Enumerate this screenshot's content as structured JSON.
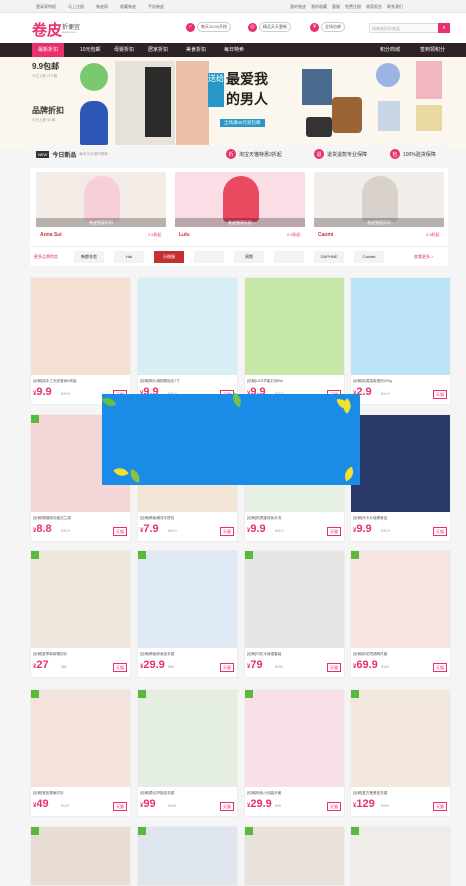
{
  "topbar": {
    "left": [
      "登录享特权",
      "马上注册",
      "卷皮网",
      "收藏卷皮",
      "手机卷皮"
    ],
    "right": [
      "我的卷皮",
      "我的收藏",
      "客服",
      "免费注册",
      "商家报名",
      "联系我们"
    ]
  },
  "header": {
    "logo": "卷皮",
    "logo_sub": "折便宜",
    "logo_url": "juanpi.com",
    "features": [
      {
        "icon": "✓",
        "text": "每天10:00开抢"
      },
      {
        "icon": "◎",
        "text": "精品天天更新"
      },
      {
        "icon": "¥",
        "text": "全场包邮"
      }
    ],
    "search_placeholder": "搜卷皮折扣商品",
    "search_icon": "search-icon"
  },
  "nav": {
    "items": [
      "最新折扣",
      "10元包邮",
      "母婴折扣",
      "居家折扣",
      "美食折扣",
      "每日特卖",
      "积分商城",
      "签到领积分"
    ],
    "active": 0
  },
  "banner": {
    "left1": "9.9包邮",
    "left1_sub": "今日上新 275 款",
    "left2": "品牌折扣",
    "left2_sub": "今日上新 90 款",
    "headline1": "送给",
    "headline2": "最爱我",
    "headline3": "的男人",
    "headline_sub": "全场满39元就包邮"
  },
  "strip": {
    "new_badge": "NEW",
    "new_text": "今日新品",
    "new_sub": "每天10点准时更新",
    "p1_icon": "折",
    "p1": "淘宝天猫特惠3折起",
    "p2_icon": "退",
    "p2": "退货退款专业保障",
    "p3_icon": "检",
    "p3": "100%验货保障"
  },
  "features": [
    {
      "brand": "Anna Sui",
      "off": "2.5折起",
      "label": "卷皮独家折扣"
    },
    {
      "brand": "Lulu",
      "off": "2.5折起",
      "label": "卷皮独家折扣"
    },
    {
      "brand": "Caomi",
      "off": "2.5折起",
      "label": "卷皮独家折扣"
    }
  ],
  "brands": {
    "lead": "更多品牌特卖",
    "items": [
      "韩都衣舍",
      "Hai",
      "乐微服",
      "",
      "周期",
      "",
      "DAPHNE",
      "Cachet"
    ],
    "more": "查看更多 >"
  },
  "products": [
    {
      "title": "[包邮]纯手工天然香皂5块装",
      "price": "9.9",
      "old": "¥29.9",
      "btn": "天猫",
      "col": "#f5e1d4"
    },
    {
      "title": "[包邮]照片墙相框组合7寸",
      "price": "9.9",
      "old": "¥29.9",
      "btn": "天猫",
      "col": "#d8eef6"
    },
    {
      "title": "[包邮]LED节能灯泡5W",
      "price": "9.9",
      "old": "¥29.9",
      "btn": "天猫",
      "col": "#c7e7a8"
    },
    {
      "title": "[包邮]除湿袋吸湿剂200g",
      "price": "2.9",
      "old": "¥19.9",
      "btn": "天猫",
      "col": "#bde3f7"
    },
    {
      "title": "[包邮]珊瑚绒毛毯法兰绒",
      "price": "8.8",
      "old": "¥39.9",
      "btn": "天猫",
      "col": "#f5d6d8"
    },
    {
      "title": "[包邮]韩版潮流手提包",
      "price": "7.9",
      "old": "¥29.9",
      "btn": "天猫",
      "col": "#f3e6d8"
    },
    {
      "title": "[包邮]拖把旋转免手洗",
      "price": "9.9",
      "old": "¥39.9",
      "btn": "天猫",
      "col": "#e7f1e3"
    },
    {
      "title": "[包邮]玛卡片保健食品",
      "price": "9.9",
      "old": "¥39.9",
      "btn": "天猫",
      "col": "#2a3a6a"
    },
    {
      "title": "[包邮]夏季新款雪纺衫",
      "price": "27",
      "old": "¥89",
      "btn": "天猫",
      "col": "#efe6dc"
    },
    {
      "title": "[包邮]韩版修身连衣裙",
      "price": "29.9",
      "old": "¥99",
      "btn": "天猫",
      "col": "#dfe8f5"
    },
    {
      "title": "[包邮]印花半身裙套装",
      "price": "79",
      "old": "¥199",
      "btn": "天猫",
      "col": "#e8e6e4"
    },
    {
      "title": "[包邮]碎花短裙两件套",
      "price": "69.9",
      "old": "¥169",
      "btn": "天猫",
      "col": "#f6e4e0"
    },
    {
      "title": "[包邮]宽松棉麻衬衫",
      "price": "49",
      "old": "¥129",
      "btn": "天猫",
      "col": "#f4e2dc"
    },
    {
      "title": "[包邮]蕾丝拼接连衣裙",
      "price": "99",
      "old": "¥199",
      "btn": "天猫",
      "col": "#e4efe2"
    },
    {
      "title": "[包邮]粉色小西装外套",
      "price": "29.9",
      "old": "¥99",
      "btn": "天猫",
      "col": "#f7e1e6"
    },
    {
      "title": "[包邮]复古蓬蓬连衣裙",
      "price": "129",
      "old": "¥299",
      "btn": "天猫",
      "col": "#f3e8dd"
    }
  ],
  "bottom_row_cols": [
    "#e7ddd4",
    "#dfe6ee",
    "#e9e2da",
    "#f0ece8"
  ],
  "popup_color": "#1a8be6"
}
